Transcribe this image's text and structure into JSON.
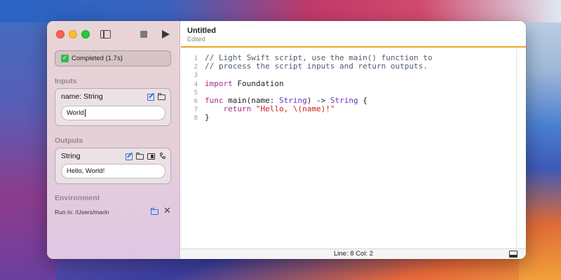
{
  "window": {
    "title": "Untitled",
    "subtitle": "Edited"
  },
  "toolbar": {
    "sidebar_toggle_icon": "sidebar-icon",
    "stop_icon": "stop-icon",
    "run_icon": "play-icon"
  },
  "status": {
    "text": "Completed (1.7s)",
    "icon": "check-icon",
    "color": "#30b94d"
  },
  "inputs": {
    "section": "Inputs",
    "items": [
      {
        "label": "name: String",
        "value": "World"
      }
    ]
  },
  "outputs": {
    "section": "Outputs",
    "items": [
      {
        "label": "String",
        "value": "Hello, World!"
      }
    ]
  },
  "environment": {
    "section": "Environment",
    "run_in": "Run in: /Users/marin"
  },
  "editor": {
    "accent": "#f0a520",
    "lines": [
      {
        "n": "1",
        "tokens": [
          {
            "cls": "c-comment",
            "text": "// Light Swift script, use the main() function to"
          }
        ]
      },
      {
        "n": "2",
        "tokens": [
          {
            "cls": "c-comment",
            "text": "// process the script inputs and return outputs."
          }
        ]
      },
      {
        "n": "3",
        "tokens": []
      },
      {
        "n": "4",
        "tokens": [
          {
            "cls": "c-kw",
            "text": "import"
          },
          {
            "cls": "c-plain",
            "text": " Foundation"
          }
        ]
      },
      {
        "n": "5",
        "tokens": []
      },
      {
        "n": "6",
        "tokens": [
          {
            "cls": "c-kw",
            "text": "func"
          },
          {
            "cls": "c-plain",
            "text": " main(name: "
          },
          {
            "cls": "c-type",
            "text": "String"
          },
          {
            "cls": "c-plain",
            "text": ") -> "
          },
          {
            "cls": "c-type",
            "text": "String"
          },
          {
            "cls": "c-plain",
            "text": " {"
          }
        ]
      },
      {
        "n": "7",
        "tokens": [
          {
            "cls": "c-plain",
            "text": "    "
          },
          {
            "cls": "c-kw",
            "text": "return"
          },
          {
            "cls": "c-plain",
            "text": " "
          },
          {
            "cls": "c-str",
            "text": "\"Hello, \\(name)!\""
          }
        ]
      },
      {
        "n": "8",
        "tokens": [
          {
            "cls": "c-plain",
            "text": "}"
          }
        ]
      }
    ]
  },
  "statusbar": {
    "position": "Line: 8 Col: 2"
  }
}
